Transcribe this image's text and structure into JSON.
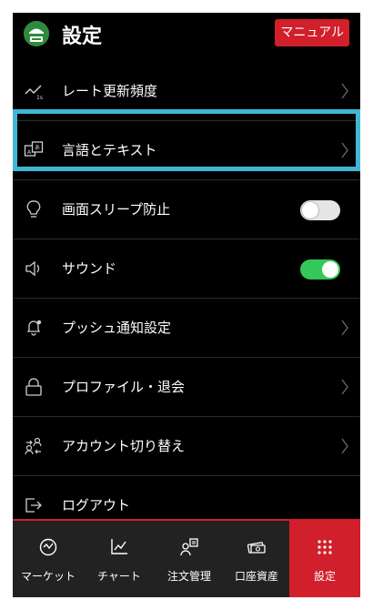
{
  "header": {
    "title": "設定",
    "manual_label": "マニュアル"
  },
  "settings": [
    {
      "id": "rate",
      "label": "レート更新頻度",
      "icon": "rate-update-icon",
      "control": "chevron"
    },
    {
      "id": "language",
      "label": "言語とテキスト",
      "icon": "language-icon",
      "control": "chevron"
    },
    {
      "id": "sleep",
      "label": "画面スリープ防止",
      "icon": "lightbulb-icon",
      "control": "toggle",
      "on": false
    },
    {
      "id": "sound",
      "label": "サウンド",
      "icon": "speaker-icon",
      "control": "toggle",
      "on": true
    },
    {
      "id": "push",
      "label": "プッシュ通知設定",
      "icon": "bell-icon",
      "control": "chevron"
    },
    {
      "id": "profile",
      "label": "プロファイル・退会",
      "icon": "lock-icon",
      "control": "chevron"
    },
    {
      "id": "switch",
      "label": "アカウント切り替え",
      "icon": "switch-account-icon",
      "control": "chevron"
    },
    {
      "id": "logout",
      "label": "ログアウト",
      "icon": "logout-icon",
      "control": "none"
    }
  ],
  "tabs": [
    {
      "label": "マーケット",
      "icon": "market-icon",
      "active": false
    },
    {
      "label": "チャート",
      "icon": "chart-icon",
      "active": false
    },
    {
      "label": "注文管理",
      "icon": "order-icon",
      "active": false
    },
    {
      "label": "口座資産",
      "icon": "assets-icon",
      "active": false
    },
    {
      "label": "設定",
      "icon": "settings-grid-icon",
      "active": true
    }
  ],
  "colors": {
    "accent": "#d11f2b",
    "highlight": "#3fb7d4",
    "toggle_on": "#34c759",
    "background": "#000000"
  }
}
